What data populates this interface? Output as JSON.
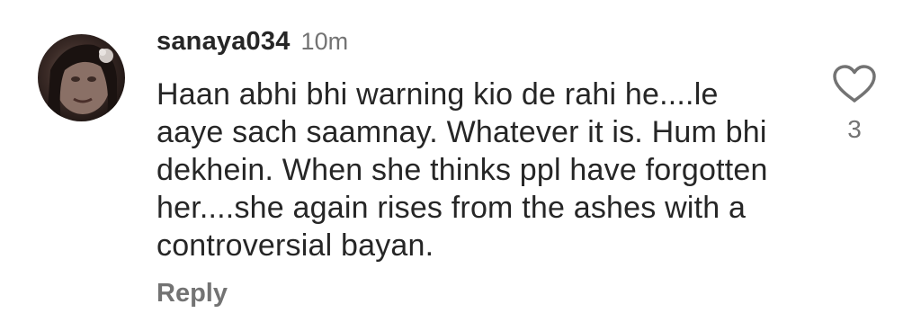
{
  "comment": {
    "username": "sanaya034",
    "time": "10m",
    "text": "Haan abhi bhi warning kio de rahi he....le aaye sach saamnay. Whatever it is. Hum bhi dekhein. When she thinks ppl have forgotten her....she again rises from the ashes with a controversial bayan.",
    "reply_label": "Reply",
    "like_count": "3",
    "like_icon": "heart-outline-icon"
  }
}
